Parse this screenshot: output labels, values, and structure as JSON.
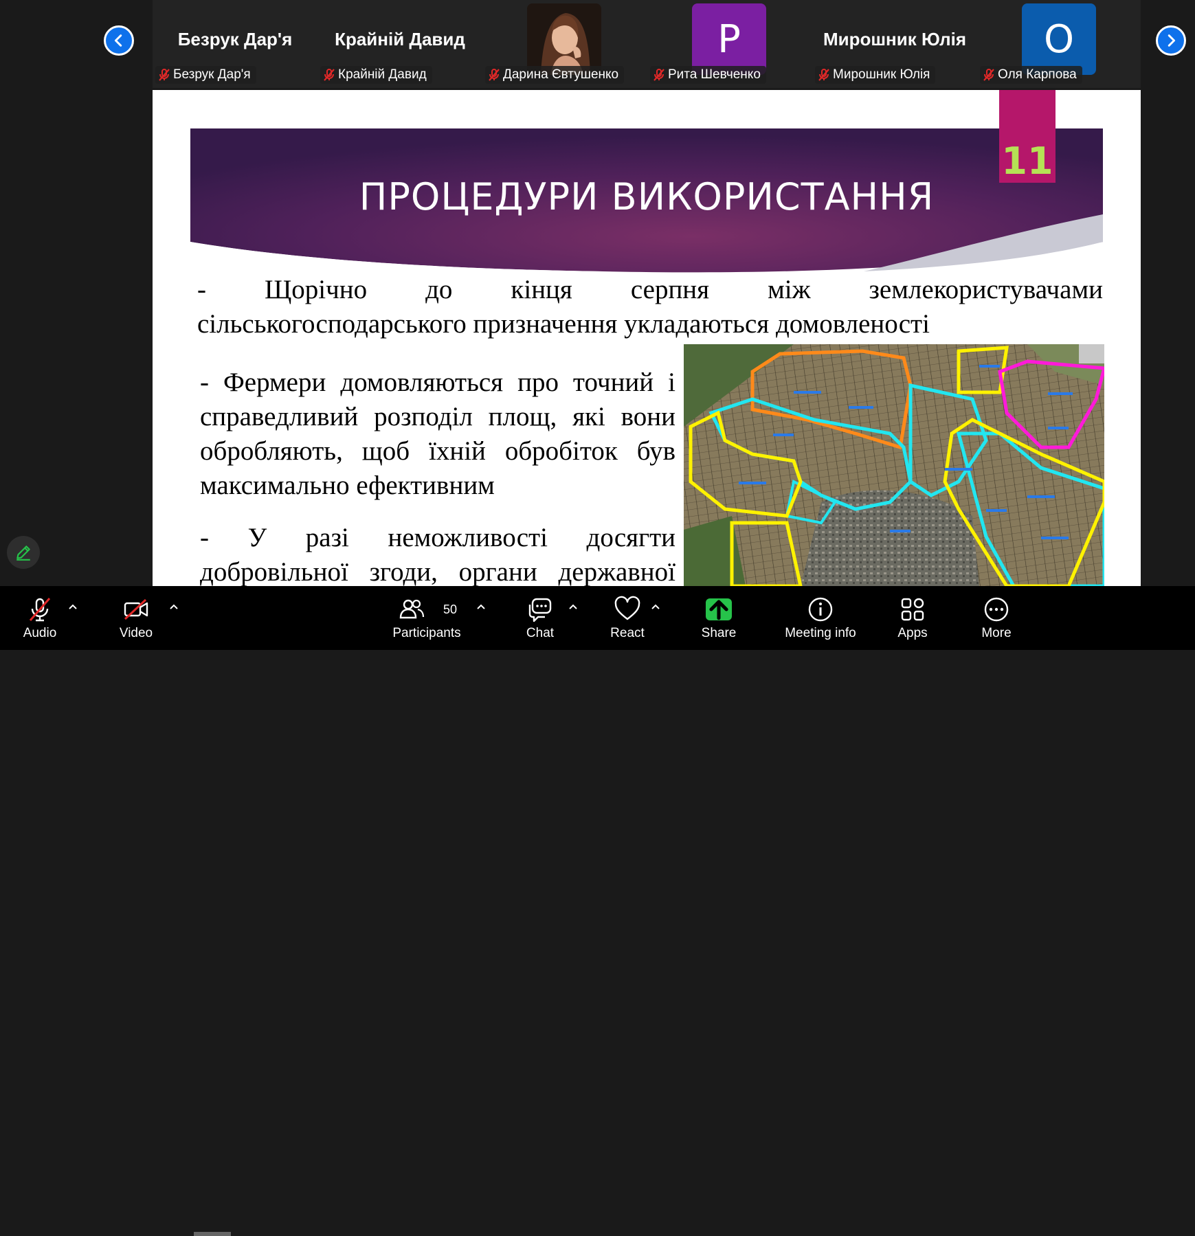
{
  "gallery": {
    "participants": [
      {
        "big_name": "Безрук Дар'я",
        "label": "Безрук Дар'я",
        "muted": true,
        "type": "name"
      },
      {
        "big_name": "Крайній Давид",
        "label": "Крайній Давид",
        "muted": true,
        "type": "name"
      },
      {
        "label": "Дарина Євтушенко",
        "muted": true,
        "type": "photo"
      },
      {
        "avatar_letter": "P",
        "avatar_color": "#7b1fa2",
        "label": "Рита Шевченко",
        "muted": true,
        "type": "avatar"
      },
      {
        "big_name": "Мирошник Юлія",
        "label": "Мирошник Юлія",
        "muted": true,
        "type": "name"
      },
      {
        "avatar_letter": "O",
        "avatar_color": "#0b5cad",
        "label": "Оля Карпова",
        "muted": true,
        "type": "avatar"
      }
    ]
  },
  "slide": {
    "title": "ПРОЦЕДУРИ ВИКОРИСТАННЯ",
    "number": "11",
    "paragraph1_line1": "- Щорічно до кінця серпня між землекористувачами",
    "paragraph1_line2": "сільськогосподарського призначення укладаються домовленості",
    "paragraph2_lines": [
      "- Фермери домовляються про точний і",
      "справедливий розподіл площ, які вони",
      "обробляють, щоб їхній обробіток був",
      "максимально ефективним"
    ],
    "paragraph3_lines": [
      "- У разі неможливості досягти",
      "добровільної згоди, органи державної"
    ],
    "colors": {
      "banner_dark": "#3a1b4f",
      "banner_mid": "#6b2a5e",
      "number_box": "#b5176a",
      "number_text": "#b5e255"
    }
  },
  "toolbar": {
    "audio": "Audio",
    "video": "Video",
    "participants": "Participants",
    "participants_count": "50",
    "chat": "Chat",
    "react": "React",
    "share": "Share",
    "meeting_info": "Meeting info",
    "apps": "Apps",
    "more": "More",
    "share_color": "#26c34a"
  },
  "nav_color": "#0e71eb"
}
